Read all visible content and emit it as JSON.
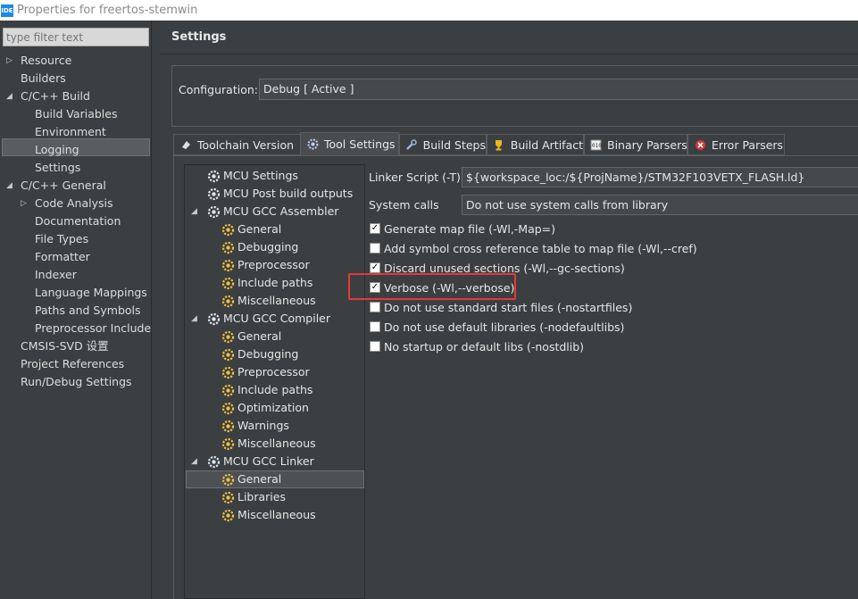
{
  "window": {
    "logo_text": "IDE",
    "title": "Properties for freertos-stemwin"
  },
  "filter": {
    "placeholder": "type filter text"
  },
  "nav": [
    {
      "label": "Resource",
      "expandable": true
    },
    {
      "label": "Builders"
    },
    {
      "label": "C/C++ Build",
      "expanded": true
    },
    {
      "label": "Build Variables"
    },
    {
      "label": "Environment"
    },
    {
      "label": "Logging"
    },
    {
      "label": "Settings",
      "selected": true
    },
    {
      "label": "C/C++ General",
      "expanded": true
    },
    {
      "label": "Code Analysis",
      "expandable": true
    },
    {
      "label": "Documentation"
    },
    {
      "label": "File Types"
    },
    {
      "label": "Formatter"
    },
    {
      "label": "Indexer"
    },
    {
      "label": "Language Mappings"
    },
    {
      "label": "Paths and Symbols"
    },
    {
      "label": "Preprocessor Include"
    },
    {
      "label": "CMSIS-SVD 设置"
    },
    {
      "label": "Project References"
    },
    {
      "label": "Run/Debug Settings"
    }
  ],
  "header": {
    "title": "Settings"
  },
  "configuration": {
    "label": "Configuration:",
    "value": "Debug  [ Active ]"
  },
  "tabs": [
    {
      "label": "Toolchain  Version",
      "icon": "chip-icon"
    },
    {
      "label": "Tool Settings",
      "icon": "gear-icon",
      "active": true
    },
    {
      "label": "Build Steps",
      "icon": "wrench-icon"
    },
    {
      "label": "Build Artifact",
      "icon": "trophy-icon"
    },
    {
      "label": "Binary Parsers",
      "icon": "binary-icon"
    },
    {
      "label": "Error Parsers",
      "icon": "error-icon"
    }
  ],
  "tool_tree": [
    {
      "label": "MCU Settings"
    },
    {
      "label": "MCU Post build outputs"
    },
    {
      "label": "MCU GCC Assembler",
      "expanded": true
    },
    {
      "label": "General"
    },
    {
      "label": "Debugging"
    },
    {
      "label": "Preprocessor"
    },
    {
      "label": "Include paths"
    },
    {
      "label": "Miscellaneous"
    },
    {
      "label": "MCU GCC Compiler",
      "expanded": true
    },
    {
      "label": "General"
    },
    {
      "label": "Debugging"
    },
    {
      "label": "Preprocessor"
    },
    {
      "label": "Include paths"
    },
    {
      "label": "Optimization"
    },
    {
      "label": "Warnings"
    },
    {
      "label": "Miscellaneous"
    },
    {
      "label": "MCU GCC Linker",
      "expanded": true
    },
    {
      "label": "General",
      "selected": true
    },
    {
      "label": "Libraries"
    },
    {
      "label": "Miscellaneous"
    }
  ],
  "linker": {
    "script_label": "Linker Script (-T)",
    "script_value": "${workspace_loc:/${ProjName}/STM32F103VETX_FLASH.ld}",
    "syscalls_label": "System calls",
    "syscalls_value": "Do not use system calls from library"
  },
  "options": [
    {
      "label": "Generate map file (-Wl,-Map=)",
      "checked": true
    },
    {
      "label": "Add symbol cross reference table to map file (-Wl,--cref)",
      "checked": false
    },
    {
      "label": "Discard unused sections (-Wl,--gc-sections)",
      "checked": true
    },
    {
      "label": "Verbose (-Wl,--verbose)",
      "checked": true
    },
    {
      "label": "Do not use standard start files (-nostartfiles)",
      "checked": false
    },
    {
      "label": "Do not use default libraries (-nodefaultlibs)",
      "checked": false
    },
    {
      "label": "No startup or default libs (-nostdlib)",
      "checked": false
    }
  ],
  "colors": {
    "highlight": "#e53935",
    "logo": "#1e88e5"
  }
}
